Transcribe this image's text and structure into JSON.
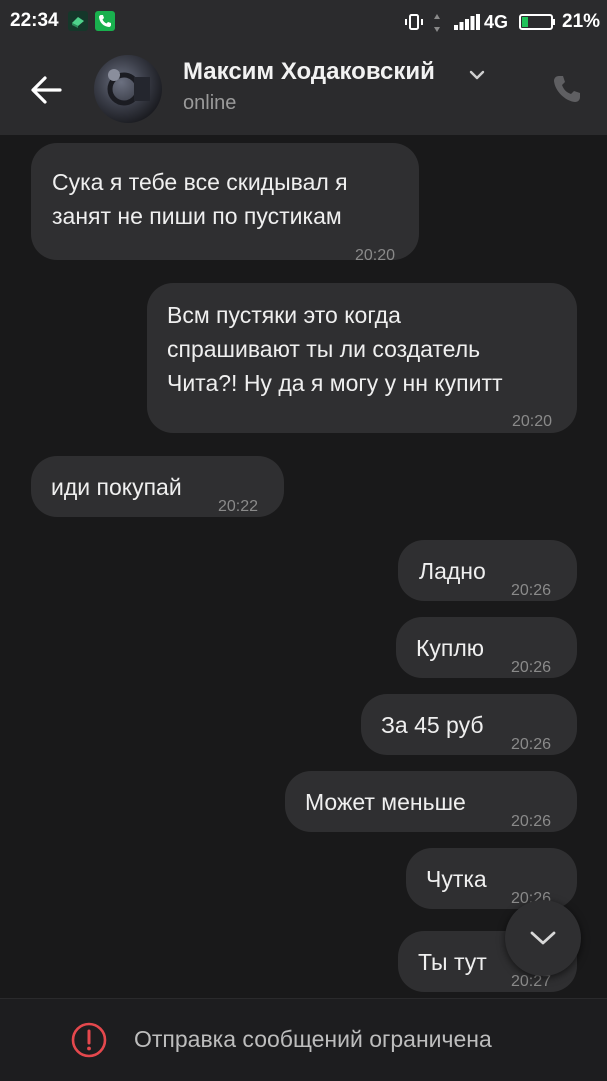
{
  "status_bar": {
    "time": "22:34",
    "network": "4G",
    "battery": "21%"
  },
  "header": {
    "name": "Максим Ходаковский",
    "status": "online"
  },
  "messages": [
    {
      "text_lines": [
        "Сука я тебе все скидывал я",
        "занят не пиши по пустикам"
      ],
      "time": "20:20",
      "outgoing": false
    },
    {
      "text_lines": [
        "Всм пустяки это когда",
        "спрашивают ты ли создатель",
        "Чита?! Ну да я могу у нн купитт"
      ],
      "time": "20:20",
      "outgoing": true
    },
    {
      "text_lines": [
        "иди покупай"
      ],
      "time": "20:22",
      "outgoing": false
    },
    {
      "text_lines": [
        "Ладно"
      ],
      "time": "20:26",
      "outgoing": true
    },
    {
      "text_lines": [
        "Куплю"
      ],
      "time": "20:26",
      "outgoing": true
    },
    {
      "text_lines": [
        "За 45 руб"
      ],
      "time": "20:26",
      "outgoing": true
    },
    {
      "text_lines": [
        "Может меньше"
      ],
      "time": "20:26",
      "outgoing": true
    },
    {
      "text_lines": [
        "Чутка"
      ],
      "time": "20:26",
      "outgoing": true
    },
    {
      "text_lines": [
        "Ты тут"
      ],
      "time": "20:27",
      "outgoing": true
    }
  ],
  "footer": {
    "restriction_text": "Отправка сообщений ограничена"
  },
  "icons": {
    "back": "arrow-left-icon",
    "call": "phone-icon",
    "scroll": "chevron-down-icon",
    "warning": "exclamation-circle-icon"
  },
  "colors": {
    "background": "#19191a",
    "bar": "#2b2b2d",
    "bubble": "#2f2f31",
    "warning": "#e5484d"
  }
}
